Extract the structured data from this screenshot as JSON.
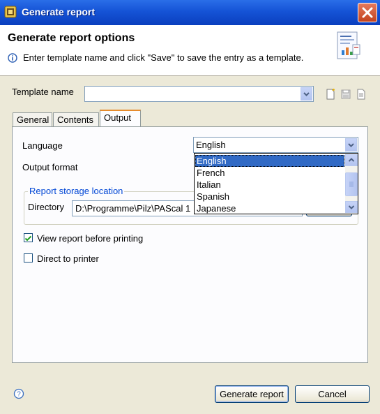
{
  "window": {
    "title": "Generate report"
  },
  "banner": {
    "heading": "Generate report options",
    "info_text": "Enter template name and click \"Save\" to save the entry as a template."
  },
  "template": {
    "label": "Template name",
    "value": ""
  },
  "tabs": [
    {
      "label": "General"
    },
    {
      "label": "Contents"
    },
    {
      "label": "Output"
    }
  ],
  "output": {
    "language_label": "Language",
    "language_value": "English",
    "language_options": [
      "English",
      "French",
      "Italian",
      "Spanish",
      "Japanese"
    ],
    "output_format_label": "Output format",
    "storage_group_title": "Report storage location",
    "directory_label": "Directory",
    "directory_value": "D:\\Programme\\Pilz\\PAScal 1",
    "view_before_print_label": "View report before printing",
    "view_before_print_checked": true,
    "direct_to_printer_label": "Direct to printer",
    "direct_to_printer_checked": false
  },
  "buttons": {
    "generate": "Generate report",
    "cancel": "Cancel"
  },
  "colors": {
    "title_bar": "#0a3fbe",
    "selection": "#316ac5",
    "active_tab_accent": "#e68b2c",
    "group_title": "#0046d5"
  }
}
